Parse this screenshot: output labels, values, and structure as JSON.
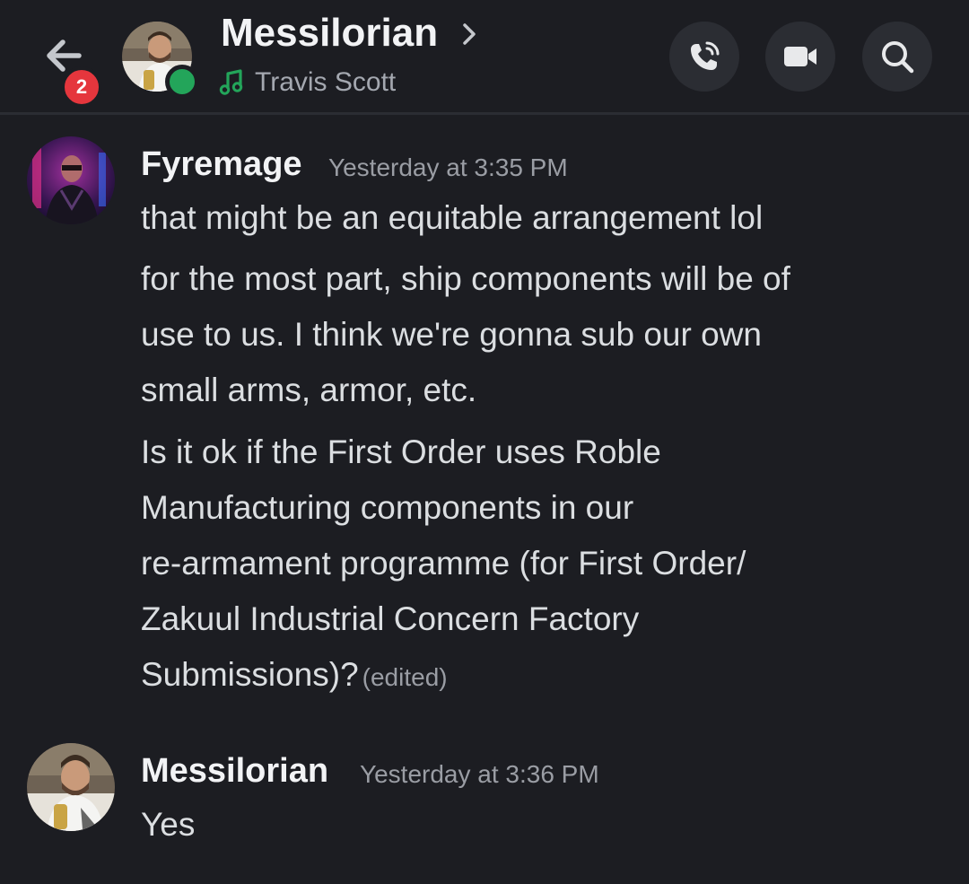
{
  "header": {
    "unread_count": "2",
    "name": "Messilorian",
    "activity": "Travis Scott",
    "icons": {
      "back": "arrow-left-icon",
      "chevron": "chevron-right-icon",
      "activity": "music-note-icon",
      "call": "phone-call-icon",
      "video": "video-camera-icon",
      "search": "search-icon"
    },
    "status_color": "#23a55a",
    "badge_color": "#e5363d"
  },
  "messages": [
    {
      "author": "Fyremage",
      "timestamp": "Yesterday at 3:35 PM",
      "lines": [
        "that might be an equitable arrangement lol",
        "for the most part, ship components will be of",
        "use to us. I think we're gonna sub our own",
        "small arms, armor, etc.",
        "Is it ok if the First Order uses Roble",
        "Manufacturing components in our",
        "re-armament programme (for First Order/",
        "Zakuul Industrial Concern Factory",
        "Submissions)?"
      ],
      "edited_label": "(edited)"
    },
    {
      "author": "Messilorian",
      "timestamp": "Yesterday at 3:36 PM",
      "lines": [
        "Yes"
      ]
    }
  ]
}
